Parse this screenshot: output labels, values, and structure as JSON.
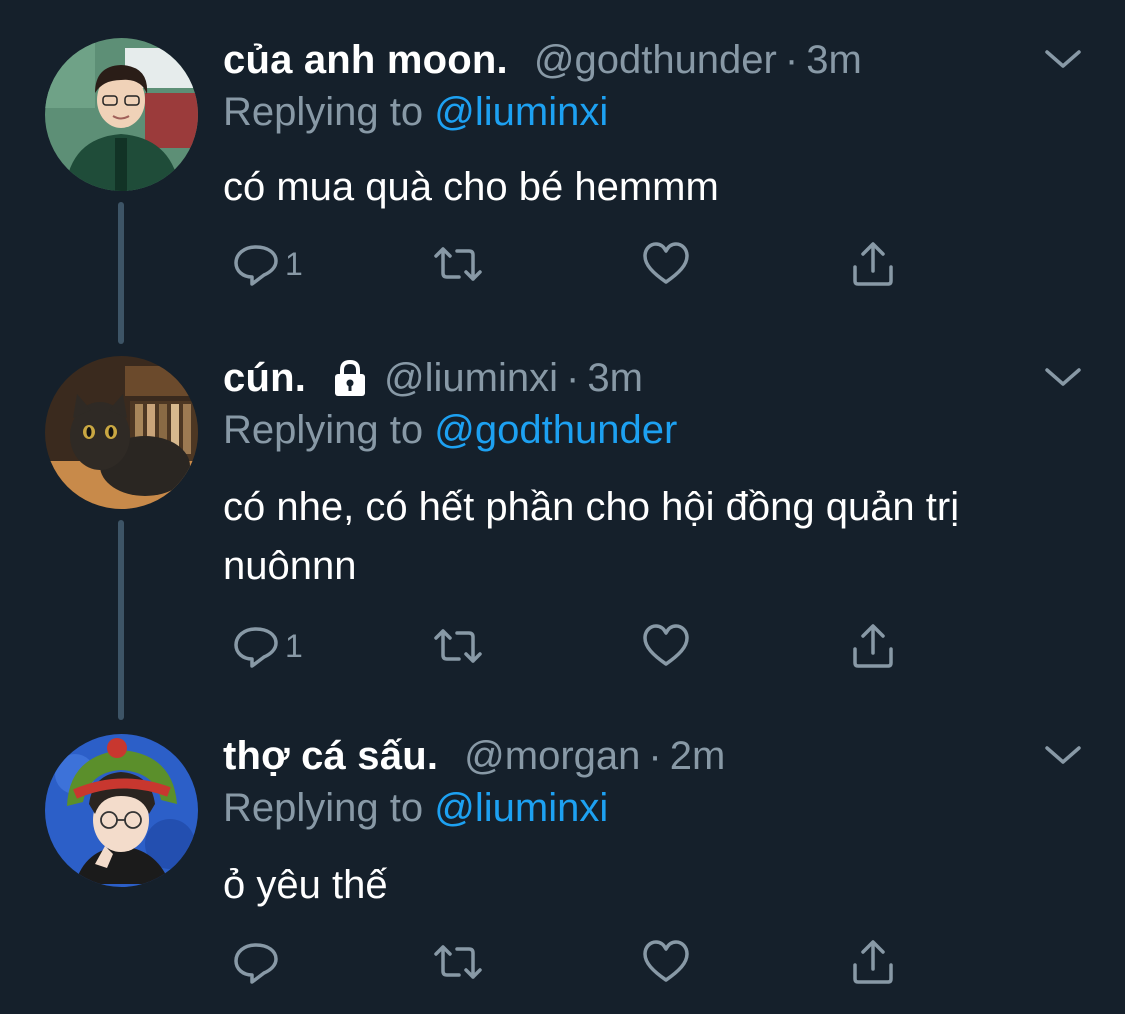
{
  "tweets": [
    {
      "display_name": "của anh moon.",
      "handle": "@godthunder",
      "separator": "·",
      "time": "3m",
      "replying_prefix": "Replying to",
      "replying_to": "@liuminxi",
      "text": "có mua quà cho bé hemmm",
      "reply_count": "1",
      "protected": false,
      "avatar": "avatar-boy-green-jacket"
    },
    {
      "display_name": "cún.",
      "handle": "@liuminxi",
      "separator": "·",
      "time": "3m",
      "replying_prefix": "Replying to",
      "replying_to": "@godthunder",
      "text": "có nhe, có hết phần cho hội đồng quản trị nuônnn",
      "reply_count": "1",
      "protected": true,
      "avatar": "avatar-cat"
    },
    {
      "display_name": "thợ cá sấu.",
      "handle": "@morgan",
      "separator": "·",
      "time": "2m",
      "replying_prefix": "Replying to",
      "replying_to": "@liuminxi",
      "text": "ỏ yêu thế",
      "reply_count": "",
      "protected": false,
      "avatar": "avatar-green-hat"
    }
  ],
  "icons": {
    "reply": "reply-icon",
    "retweet": "retweet-icon",
    "like": "like-icon",
    "share": "share-icon",
    "caret": "chevron-down-icon",
    "lock": "lock-icon"
  },
  "colors": {
    "background": "#15202b",
    "primary_text": "#ffffff",
    "secondary_text": "#8899a6",
    "link": "#1da1f2",
    "thread_line": "#3d5466"
  }
}
